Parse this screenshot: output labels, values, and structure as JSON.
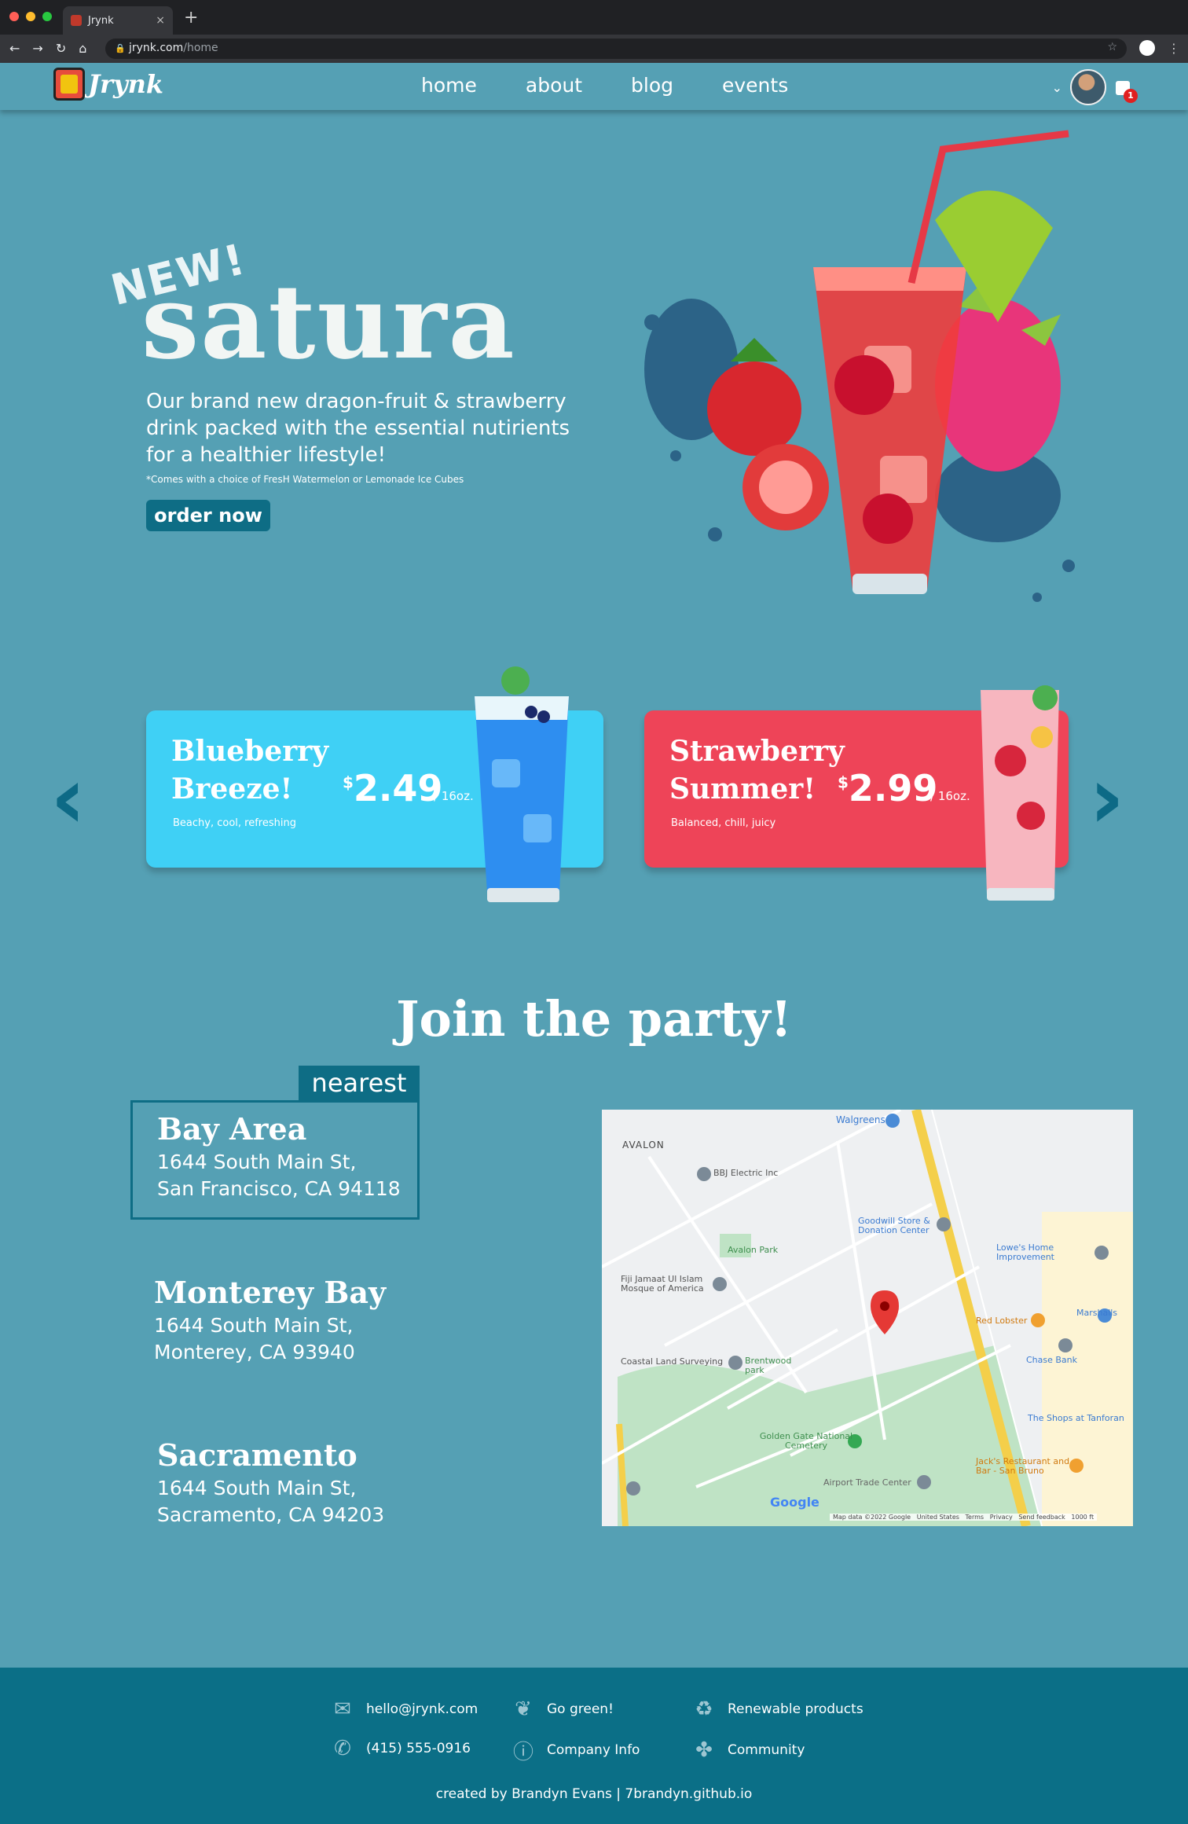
{
  "browser": {
    "tab_title": "Jrynk",
    "tab_close": "×",
    "new_tab": "+",
    "url_host": "jrynk.com",
    "url_path": "/home"
  },
  "brand": {
    "logo_text": "Jrynk"
  },
  "nav": {
    "items": [
      "home",
      "about",
      "blog",
      "events"
    ]
  },
  "cart": {
    "count": "1"
  },
  "hero": {
    "badge": "NEW!",
    "title": "satura",
    "description": "Our brand new dragon-fruit & strawberry drink packed with the essential nutirients for a healthier lifestyle!",
    "note": "*Comes with a choice of FresH Watermelon or Lemonade Ice Cubes",
    "cta": "order now"
  },
  "products": [
    {
      "name_line1": "Blueberry",
      "name_line2": "Breeze!",
      "currency": "$",
      "price": "2.49",
      "unit": "/ 16oz.",
      "tagline": "Beachy, cool, refreshing",
      "color": "#3fd0f5"
    },
    {
      "name_line1": "Strawberry",
      "name_line2": "Summer!",
      "currency": "$",
      "price": "2.99",
      "unit": "/ 16oz.",
      "tagline": "Balanced, chill, juicy",
      "color": "#ee4458"
    }
  ],
  "arrows": {
    "prev": "‹",
    "next": "›"
  },
  "join": {
    "title": "Join the party!",
    "nearest_label": "nearest",
    "locations": [
      {
        "name": "Bay Area",
        "street": "1644 South Main St,",
        "city": "San Francisco, CA 94118"
      },
      {
        "name": "Monterey Bay",
        "street": "1644 South Main St,",
        "city": "Monterey, CA 93940"
      },
      {
        "name": "Sacramento",
        "street": "1644 South Main St,",
        "city": "Sacramento, CA 94203"
      }
    ]
  },
  "map": {
    "labels": {
      "avalon": "AVALON",
      "walgreens": "Walgreens",
      "bbj": "BBJ Electric Inc",
      "goodwill": "Goodwill Store & Donation Center",
      "lowes": "Lowe's Home Improvement",
      "avalon_park": "Avalon Park",
      "fiji": "Fiji Jamaat Ul Islam Mosque of America",
      "red_lobster": "Red Lobster",
      "marshalls": "Marshalls",
      "chase": "Chase Bank",
      "coastal": "Coastal Land Surveying",
      "brentwood": "Brentwood park",
      "shops": "The Shops at Tanforan",
      "golden_gate": "Golden Gate National Cemetery",
      "jacks": "Jack's Restaurant and Bar - San Bruno",
      "airport": "Airport Trade Center",
      "google": "Google",
      "attribution": "Map data ©2022 Google   United States   Terms   Privacy   Send feedback   1000 ft"
    }
  },
  "footer": {
    "email": "hello@jrynk.com",
    "phone": "(415) 555-0916",
    "go_green": "Go green!",
    "company_info": "Company Info",
    "renewable": "Renewable products",
    "community": "Community",
    "credit": "created by Brandyn Evans | 7brandyn.github.io"
  }
}
